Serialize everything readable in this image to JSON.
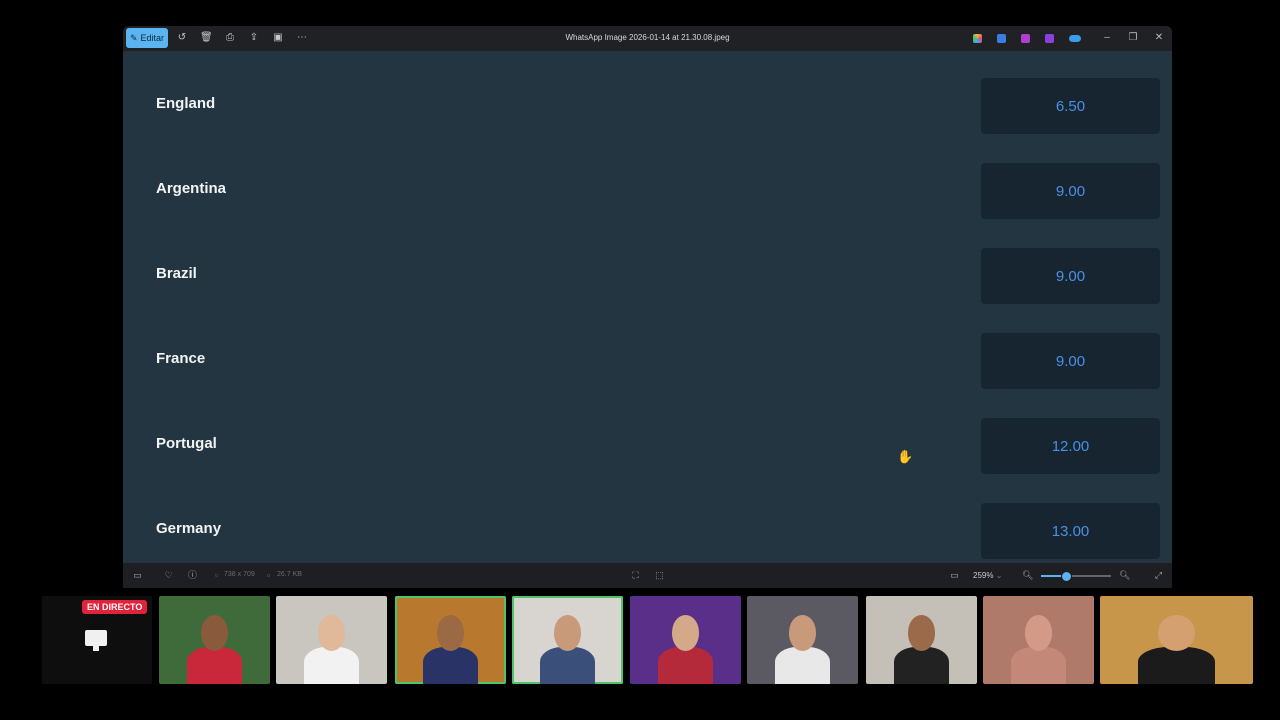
{
  "titlebar": {
    "edit_label": "Editar",
    "title": "WhatsApp Image 2026-01-14 at 21.30.08.jpeg",
    "icons": [
      "rotate-icon",
      "delete-icon",
      "print-icon",
      "share-icon",
      "frame-icon",
      "more-icon"
    ],
    "app_icons": [
      "copilot-icon",
      "edit-pen-icon",
      "clipchamp-icon",
      "designer-icon",
      "onedrive-icon"
    ]
  },
  "rows": [
    {
      "team": "England",
      "odds": "6.50"
    },
    {
      "team": "Argentina",
      "odds": "9.00"
    },
    {
      "team": "Brazil",
      "odds": "9.00"
    },
    {
      "team": "France",
      "odds": "9.00"
    },
    {
      "team": "Portugal",
      "odds": "12.00"
    },
    {
      "team": "Germany",
      "odds": "13.00"
    }
  ],
  "statusbar": {
    "dimensions": "738 x 709",
    "filesize": "26.7 KB",
    "zoom": "259%",
    "zoom_fraction": 0.35
  },
  "stream": {
    "live_label": "EN DIRECTO",
    "cams": [
      {
        "bg": "#3f6b3a",
        "skin": "#8a5a3c",
        "shirt": "#c8283a",
        "active": false
      },
      {
        "bg": "#c9c6c0",
        "skin": "#e0b89a",
        "shirt": "#f2f2f2",
        "active": false
      },
      {
        "bg": "#b8792f",
        "skin": "#9b6a45",
        "shirt": "#2a3366",
        "active": true
      },
      {
        "bg": "#d8d4cf",
        "skin": "#c99a7a",
        "shirt": "#3a4f7a",
        "active": true
      },
      {
        "bg": "#5a2f8a",
        "skin": "#d4a98a",
        "shirt": "#b52a3a",
        "active": false
      },
      {
        "bg": "#5b5a62",
        "skin": "#c89a7a",
        "shirt": "#e8e8e8",
        "active": false
      },
      {
        "bg": "#c4c0b8",
        "skin": "#9a6a4a",
        "shirt": "#222222",
        "active": false
      },
      {
        "bg": "#b07a6a",
        "skin": "#d49a88",
        "shirt": "#c48878",
        "active": false
      },
      {
        "bg": "#c8964a",
        "skin": "#d4a070",
        "shirt": "#1b1b1b",
        "active": false
      }
    ]
  }
}
